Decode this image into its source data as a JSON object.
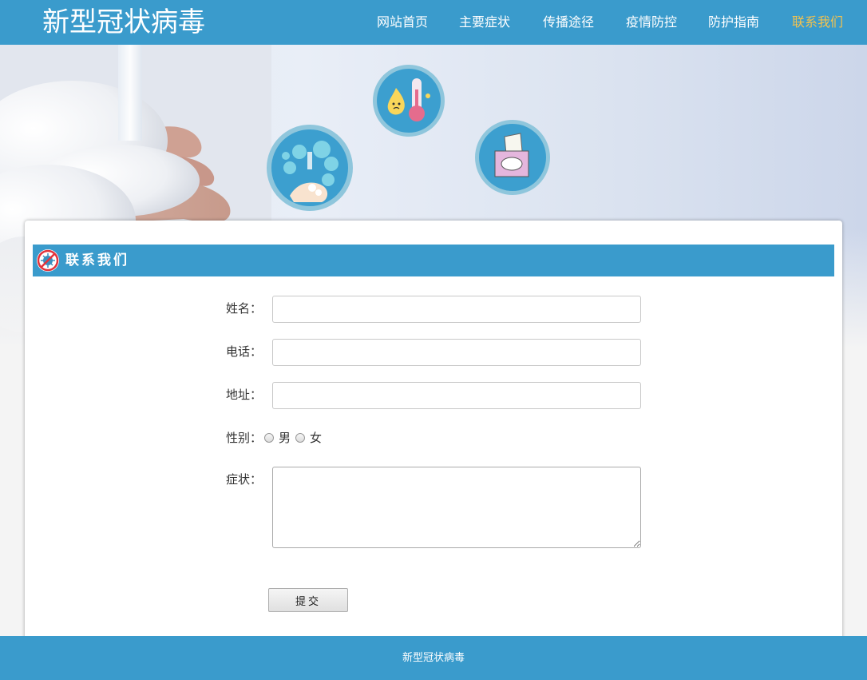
{
  "header": {
    "logo": "新型冠状病毒",
    "nav": [
      {
        "label": "网站首页",
        "active": false
      },
      {
        "label": "主要症状",
        "active": false
      },
      {
        "label": "传播途径",
        "active": false
      },
      {
        "label": "疫情防控",
        "active": false
      },
      {
        "label": "防护指南",
        "active": false
      },
      {
        "label": "联系我们",
        "active": true
      }
    ]
  },
  "hero": {
    "icons": [
      "hand-washing-icon",
      "fever-thermometer-icon",
      "tissue-box-icon"
    ]
  },
  "section": {
    "title": "联系我们",
    "icon": "no-virus-icon"
  },
  "form": {
    "name_label": "姓名：",
    "name_value": "",
    "phone_label": "电话：",
    "phone_value": "",
    "address_label": "地址：",
    "address_value": "",
    "gender_label": "性别：",
    "gender_options": [
      "男",
      "女"
    ],
    "symptoms_label": "症状：",
    "symptoms_value": "",
    "submit_label": "提交"
  },
  "footer": {
    "text": "新型冠状病毒"
  },
  "colors": {
    "brand_blue": "#3a9bcc",
    "active_nav": "#f2c24f"
  }
}
